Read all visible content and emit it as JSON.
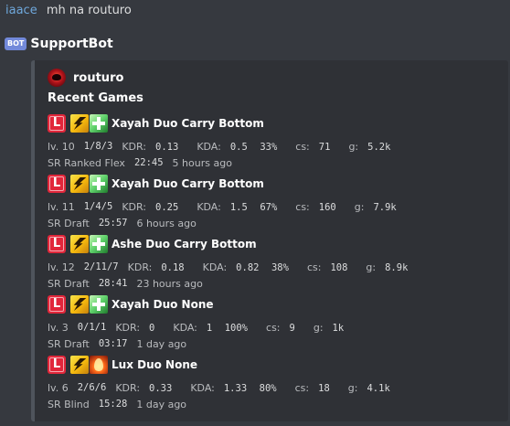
{
  "message": {
    "author": "iaace",
    "text": "mh na routuro"
  },
  "bot": {
    "tag": "BOT",
    "name": "SupportBot"
  },
  "embed": {
    "author_name": "routuro",
    "title": "Recent Games",
    "games": [
      {
        "result": "L",
        "spell2": "heal",
        "title": "Xayah Duo Carry Bottom",
        "level": "lv. 10",
        "score": "1/8/3",
        "kdr_label": "KDR:",
        "kdr": "0.13",
        "kda_label": "KDA:",
        "kda": "0.5",
        "pct": "33%",
        "cs_label": "cs:",
        "cs": "71",
        "g_label": "g:",
        "gold": "5.2k",
        "queue": "SR Ranked Flex",
        "duration": "22:45",
        "ago": "5 hours ago"
      },
      {
        "result": "L",
        "spell2": "heal",
        "title": "Xayah Duo Carry Bottom",
        "level": "lv. 11",
        "score": "1/4/5",
        "kdr_label": "KDR:",
        "kdr": "0.25",
        "kda_label": "KDA:",
        "kda": "1.5",
        "pct": "67%",
        "cs_label": "cs:",
        "cs": "160",
        "g_label": "g:",
        "gold": "7.9k",
        "queue": "SR Draft",
        "duration": "25:57",
        "ago": "6 hours ago"
      },
      {
        "result": "L",
        "spell2": "heal",
        "title": "Ashe Duo Carry Bottom",
        "level": "lv. 12",
        "score": "2/11/7",
        "kdr_label": "KDR:",
        "kdr": "0.18",
        "kda_label": "KDA:",
        "kda": "0.82",
        "pct": "38%",
        "cs_label": "cs:",
        "cs": "108",
        "g_label": "g:",
        "gold": "8.9k",
        "queue": "SR Draft",
        "duration": "28:41",
        "ago": "23 hours ago"
      },
      {
        "result": "L",
        "spell2": "heal",
        "title": "Xayah Duo None",
        "level": "lv. 3",
        "score": "0/1/1",
        "kdr_label": "KDR:",
        "kdr": "0",
        "kda_label": "KDA:",
        "kda": "1",
        "pct": "100%",
        "cs_label": "cs:",
        "cs": "9",
        "g_label": "g:",
        "gold": "1k",
        "queue": "SR Draft",
        "duration": "03:17",
        "ago": "1 day ago"
      },
      {
        "result": "L",
        "spell2": "ignite",
        "title": "Lux Duo None",
        "level": "lv. 6",
        "score": "2/6/6",
        "kdr_label": "KDR:",
        "kdr": "0.33",
        "kda_label": "KDA:",
        "kda": "1.33",
        "pct": "80%",
        "cs_label": "cs:",
        "cs": "18",
        "g_label": "g:",
        "gold": "4.1k",
        "queue": "SR Blind",
        "duration": "15:28",
        "ago": "1 day ago"
      }
    ]
  },
  "colors": {
    "background": "#36393f",
    "embed": "#2f3136",
    "loss": "#e1263a",
    "author": "#6fa8dc"
  }
}
